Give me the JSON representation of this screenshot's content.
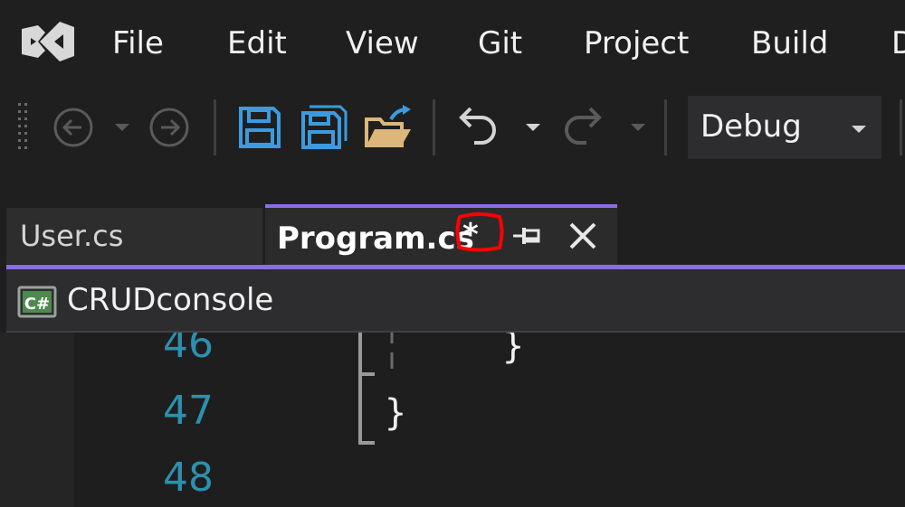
{
  "menu": {
    "items": [
      {
        "label": "File"
      },
      {
        "label": "Edit"
      },
      {
        "label": "View"
      },
      {
        "label": "Git"
      },
      {
        "label": "Project"
      },
      {
        "label": "Build"
      },
      {
        "label": "D"
      }
    ]
  },
  "toolbar": {
    "configuration": "Debug",
    "icons": [
      "back-icon",
      "forward-icon",
      "save-icon",
      "save-all-icon",
      "open-folder-icon",
      "undo-icon",
      "redo-icon"
    ]
  },
  "tabs": {
    "inactive": {
      "label": "User.cs"
    },
    "active": {
      "label": "Program.cs",
      "dirty_marker": "*"
    }
  },
  "navbar": {
    "project": "CRUDconsole",
    "project_icon_text": "C#"
  },
  "editor": {
    "lines": [
      {
        "number": "46",
        "code": "}"
      },
      {
        "number": "47",
        "code": "}"
      },
      {
        "number": "48",
        "code": ""
      }
    ]
  },
  "colors": {
    "accent": "#8b6ce8",
    "line_number": "#2b91af",
    "save_icon": "#3c9be0",
    "folder_icon": "#dcb67a",
    "annotation": "#ff0000"
  }
}
